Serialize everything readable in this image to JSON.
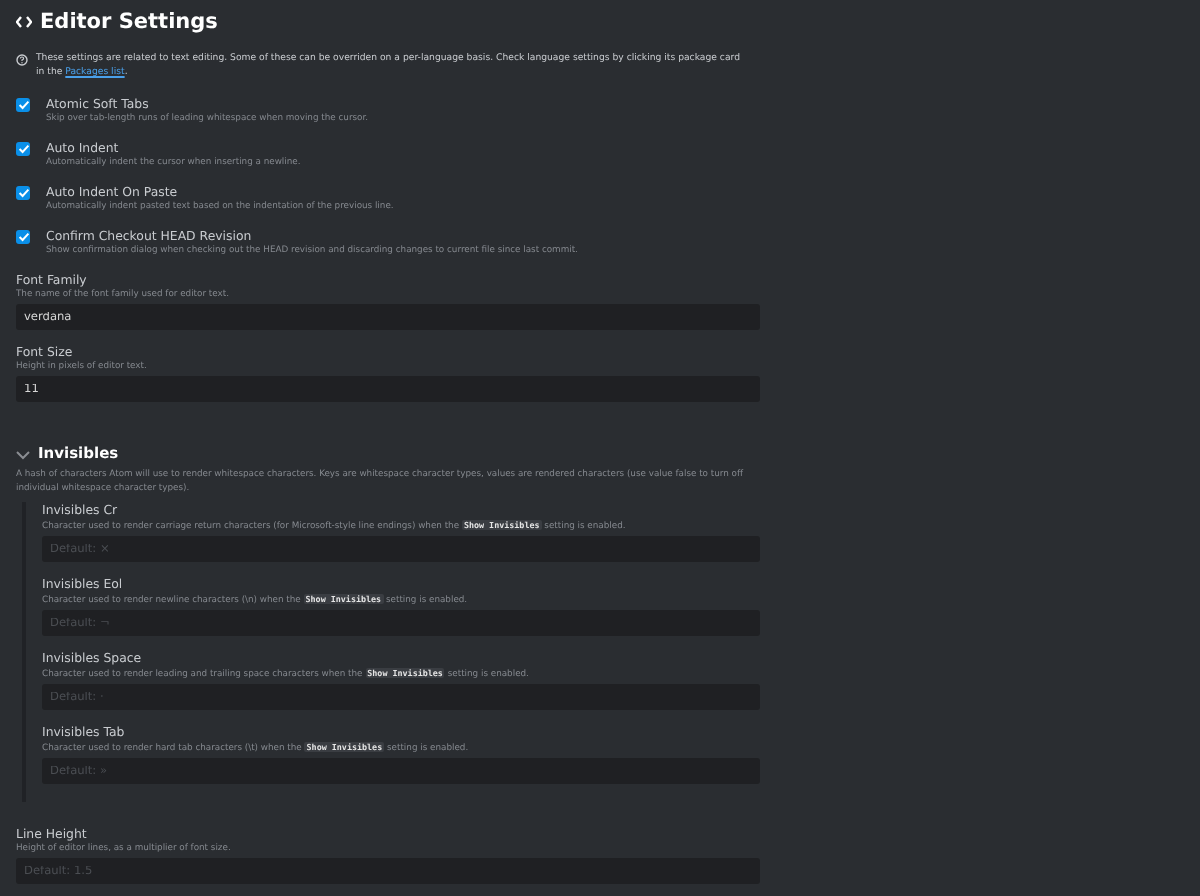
{
  "title": "Editor Settings",
  "intro": {
    "text": "These settings are related to text editing. Some of these can be overriden on a per-language basis. Check language settings by clicking its package card in the ",
    "link": "Packages list",
    "after": "."
  },
  "settings": [
    {
      "kind": "checkbox",
      "label": "Atomic Soft Tabs",
      "checked": true,
      "description": [
        {
          "kind": "text",
          "text": "Skip over tab-length runs of leading whitespace when moving the cursor."
        }
      ]
    },
    {
      "kind": "checkbox",
      "label": "Auto Indent",
      "checked": true,
      "description": [
        {
          "kind": "text",
          "text": "Automatically indent the cursor when inserting a newline."
        }
      ]
    },
    {
      "kind": "checkbox",
      "label": "Auto Indent On Paste",
      "checked": true,
      "description": [
        {
          "kind": "text",
          "text": "Automatically indent pasted text based on the indentation of the previous line."
        }
      ]
    },
    {
      "kind": "checkbox",
      "label": "Confirm Checkout HEAD Revision",
      "checked": true,
      "description": [
        {
          "kind": "text",
          "text": "Show confirmation dialog when checking out the HEAD revision and discarding changes to current file since last commit."
        }
      ]
    },
    {
      "kind": "field",
      "label": "Font Family",
      "value": "verdana",
      "description": [
        {
          "kind": "text",
          "text": "The name of the font family used for editor text."
        }
      ]
    },
    {
      "kind": "field",
      "label": "Font Size",
      "value": "11",
      "description": [
        {
          "kind": "text",
          "text": "Height in pixels of editor text."
        }
      ]
    }
  ],
  "section": {
    "title": "Invisibles",
    "expanded": true,
    "description": "A hash of characters Atom will use to render whitespace characters. Keys are whitespace character types, values are rendered characters (use value false to turn off individual whitespace character types).",
    "settings": [
      {
        "kind": "field",
        "label": "Invisibles Cr",
        "placeholder": "Default: ×",
        "description": [
          {
            "kind": "text",
            "text": "Character used to render carriage return characters (for Microsoft-style line endings) when the "
          },
          {
            "kind": "code",
            "text": "Show Invisibles"
          },
          {
            "kind": "text",
            "text": " setting is enabled."
          }
        ]
      },
      {
        "kind": "field",
        "label": "Invisibles Eol",
        "placeholder": "Default: ¬",
        "description": [
          {
            "kind": "text",
            "text": "Character used to render newline characters (\\n) when the "
          },
          {
            "kind": "code",
            "text": "Show Invisibles"
          },
          {
            "kind": "text",
            "text": " setting is enabled."
          }
        ]
      },
      {
        "kind": "field",
        "label": "Invisibles Space",
        "placeholder": "Default: ·",
        "description": [
          {
            "kind": "text",
            "text": "Character used to render leading and trailing space characters when the "
          },
          {
            "kind": "code",
            "text": "Show Invisibles"
          },
          {
            "kind": "text",
            "text": " setting is enabled."
          }
        ]
      },
      {
        "kind": "field",
        "label": "Invisibles Tab",
        "placeholder": "Default: »",
        "description": [
          {
            "kind": "text",
            "text": "Character used to render hard tab characters (\\t) when the "
          },
          {
            "kind": "code",
            "text": "Show Invisibles"
          },
          {
            "kind": "text",
            "text": " setting is enabled."
          }
        ]
      }
    ]
  },
  "more_settings": [
    {
      "kind": "field",
      "label": "Line Height",
      "placeholder": "Default: 1.5",
      "description": [
        {
          "kind": "text",
          "text": "Height of editor lines, as a multiplier of font size."
        }
      ]
    }
  ]
}
